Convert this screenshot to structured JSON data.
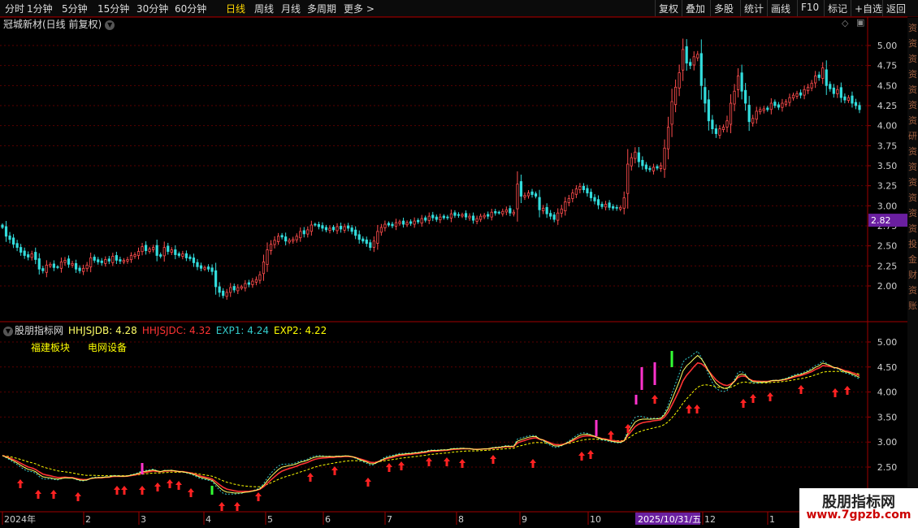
{
  "toolbar": {
    "left": [
      "分时",
      "1分钟",
      "5分钟",
      "15分钟",
      "30分钟",
      "60分钟",
      "日线",
      "周线",
      "月线",
      "多周期",
      "更多 >"
    ],
    "active": "日线",
    "right": [
      "复权",
      "叠加",
      "多股",
      "统计",
      "画线",
      "F10",
      "标记",
      "+自选",
      "返回"
    ]
  },
  "main_chart": {
    "title": "冠城新材(日线 前复权)",
    "price_axis": [
      "5.00",
      "4.75",
      "4.50",
      "4.25",
      "4.00",
      "3.75",
      "3.50",
      "3.25",
      "3.00",
      "2.75",
      "2.50",
      "2.25",
      "2.00"
    ],
    "price_marker": "2.82"
  },
  "indicator": {
    "name": "股朋指标网",
    "values": [
      {
        "label": "HHJSJDB: 4.28",
        "color": "#ffff66"
      },
      {
        "label": "HHJSJDC: 4.32",
        "color": "#ff3333"
      },
      {
        "label": "EXP1: 4.24",
        "color": "#33cccc"
      },
      {
        "label": "EXP2: 4.22",
        "color": "#ffff00"
      }
    ],
    "tags": [
      "福建板块",
      "电网设备"
    ],
    "axis": [
      "5.00",
      "4.50",
      "4.00",
      "3.50",
      "3.00",
      "2.50"
    ]
  },
  "time_axis": {
    "labels": [
      "2024年",
      "2",
      "3",
      "4",
      "5",
      "6",
      "7",
      "8",
      "9",
      "10",
      "2025/10/31/五",
      "12",
      "1"
    ]
  },
  "right_strip": [
    "资",
    "资",
    "资",
    "资",
    "资",
    "资",
    "资",
    "研",
    "资",
    "资",
    "资",
    "资",
    "资",
    "资",
    "投",
    "金",
    "财",
    "资",
    "账"
  ],
  "watermark": {
    "line1": "股朋指标网",
    "line2": "www.7gpzb.com"
  },
  "colors": {
    "up": "#ff4d4d",
    "down": "#33dddd",
    "grid": "#5a0000",
    "axis": "#a00000",
    "text": "#d0d0d0",
    "marker": "#6a1fa0"
  },
  "chart_data": {
    "type": "candlestick",
    "title": "冠城新材(日线 前复权)",
    "ylim": [
      1.8,
      5.2
    ],
    "close": [
      2.73,
      2.62,
      2.58,
      2.52,
      2.48,
      2.42,
      2.38,
      2.36,
      2.4,
      2.33,
      2.21,
      2.19,
      2.26,
      2.27,
      2.23,
      2.23,
      2.3,
      2.32,
      2.27,
      2.28,
      2.21,
      2.19,
      2.22,
      2.26,
      2.35,
      2.32,
      2.3,
      2.29,
      2.33,
      2.31,
      2.37,
      2.32,
      2.31,
      2.32,
      2.33,
      2.38,
      2.39,
      2.43,
      2.49,
      2.44,
      2.46,
      2.48,
      2.38,
      2.37,
      2.48,
      2.43,
      2.45,
      2.39,
      2.38,
      2.4,
      2.35,
      2.34,
      2.29,
      2.24,
      2.22,
      2.23,
      2.21,
      2.18,
      1.99,
      1.92,
      1.88,
      1.92,
      1.98,
      1.95,
      1.98,
      1.99,
      2.03,
      2.02,
      2.06,
      2.08,
      2.14,
      2.3,
      2.45,
      2.52,
      2.57,
      2.62,
      2.61,
      2.56,
      2.57,
      2.58,
      2.62,
      2.68,
      2.65,
      2.7,
      2.76,
      2.76,
      2.74,
      2.72,
      2.7,
      2.72,
      2.7,
      2.74,
      2.71,
      2.74,
      2.72,
      2.68,
      2.63,
      2.58,
      2.56,
      2.53,
      2.48,
      2.56,
      2.68,
      2.73,
      2.77,
      2.76,
      2.75,
      2.79,
      2.8,
      2.77,
      2.79,
      2.78,
      2.81,
      2.8,
      2.84,
      2.82,
      2.87,
      2.85,
      2.83,
      2.86,
      2.85,
      2.85,
      2.9,
      2.88,
      2.88,
      2.89,
      2.86,
      2.87,
      2.82,
      2.84,
      2.87,
      2.88,
      2.87,
      2.92,
      2.91,
      2.91,
      2.93,
      2.95,
      2.91,
      2.92,
      3.27,
      3.12,
      3.13,
      3.16,
      3.14,
      3.12,
      2.95,
      2.97,
      2.9,
      2.87,
      2.83,
      2.91,
      2.96,
      3.05,
      3.09,
      3.16,
      3.21,
      3.24,
      3.2,
      3.16,
      3.1,
      3.06,
      3.01,
      2.99,
      3.02,
      2.98,
      2.97,
      2.97,
      2.98,
      3.1,
      3.52,
      3.6,
      3.67,
      3.55,
      3.5,
      3.46,
      3.45,
      3.48,
      3.47,
      3.5,
      3.72,
      3.98,
      4.3,
      4.48,
      4.66,
      4.95,
      4.78,
      4.75,
      4.86,
      4.89,
      4.5,
      4.28,
      4.06,
      3.96,
      3.9,
      3.96,
      3.98,
      4.06,
      4.28,
      4.43,
      4.62,
      4.43,
      4.28,
      4.05,
      4.09,
      4.18,
      4.2,
      4.21,
      4.2,
      4.28,
      4.25,
      4.23,
      4.28,
      4.3,
      4.35,
      4.38,
      4.4,
      4.38,
      4.45,
      4.48,
      4.53,
      4.62,
      4.6,
      4.72,
      4.5,
      4.46,
      4.4,
      4.45,
      4.35,
      4.32,
      4.35,
      4.28,
      4.25,
      4.2
    ]
  }
}
